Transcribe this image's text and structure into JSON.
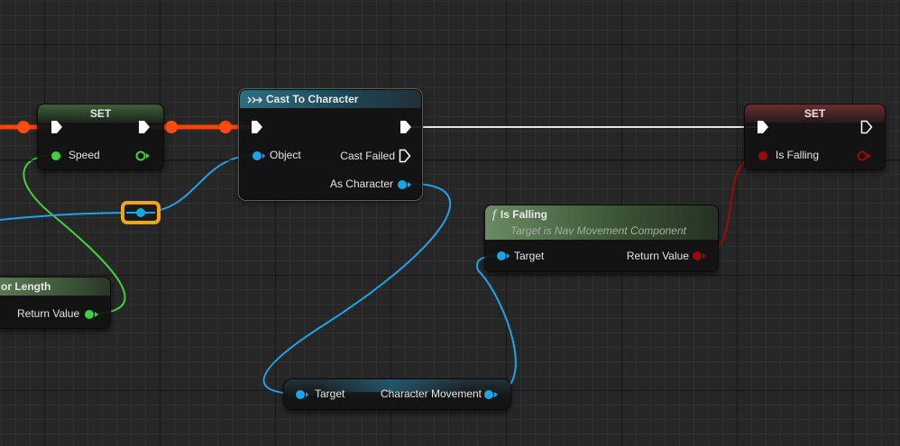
{
  "nodes": {
    "set_speed": {
      "title": "SET",
      "pin_speed": "Speed"
    },
    "cast": {
      "title": "Cast To Character",
      "pin_object": "Object",
      "pin_cast_failed": "Cast Failed",
      "pin_as_character": "As Character"
    },
    "set_falling": {
      "title": "SET",
      "pin_is_falling": "Is Falling"
    },
    "is_falling_fn": {
      "title": "Is Falling",
      "subtitle": "Target is Nav Movement Component",
      "icon_glyph": "f",
      "pin_target": "Target",
      "pin_return": "Return Value"
    },
    "vector_length": {
      "title": "or Length",
      "pin_return": "Return Value"
    },
    "char_movement": {
      "pin_target": "Target",
      "pin_char_movement": "Character Movement"
    }
  },
  "pin_colors": {
    "exec": "#ffffff",
    "float": "#3fd23d",
    "object": "#19a6e8",
    "bool": "#9a0a0a"
  },
  "wire_colors": {
    "exec_active": "#ff4200",
    "exec": "#e6e6e6",
    "float": "#3fd23d",
    "object": "#19a6e8",
    "bool": "#9a0a0a"
  },
  "icons": {
    "cast_header": "cast-icon",
    "function_header": "function-icon",
    "reroute": "reroute-knot-icon"
  }
}
